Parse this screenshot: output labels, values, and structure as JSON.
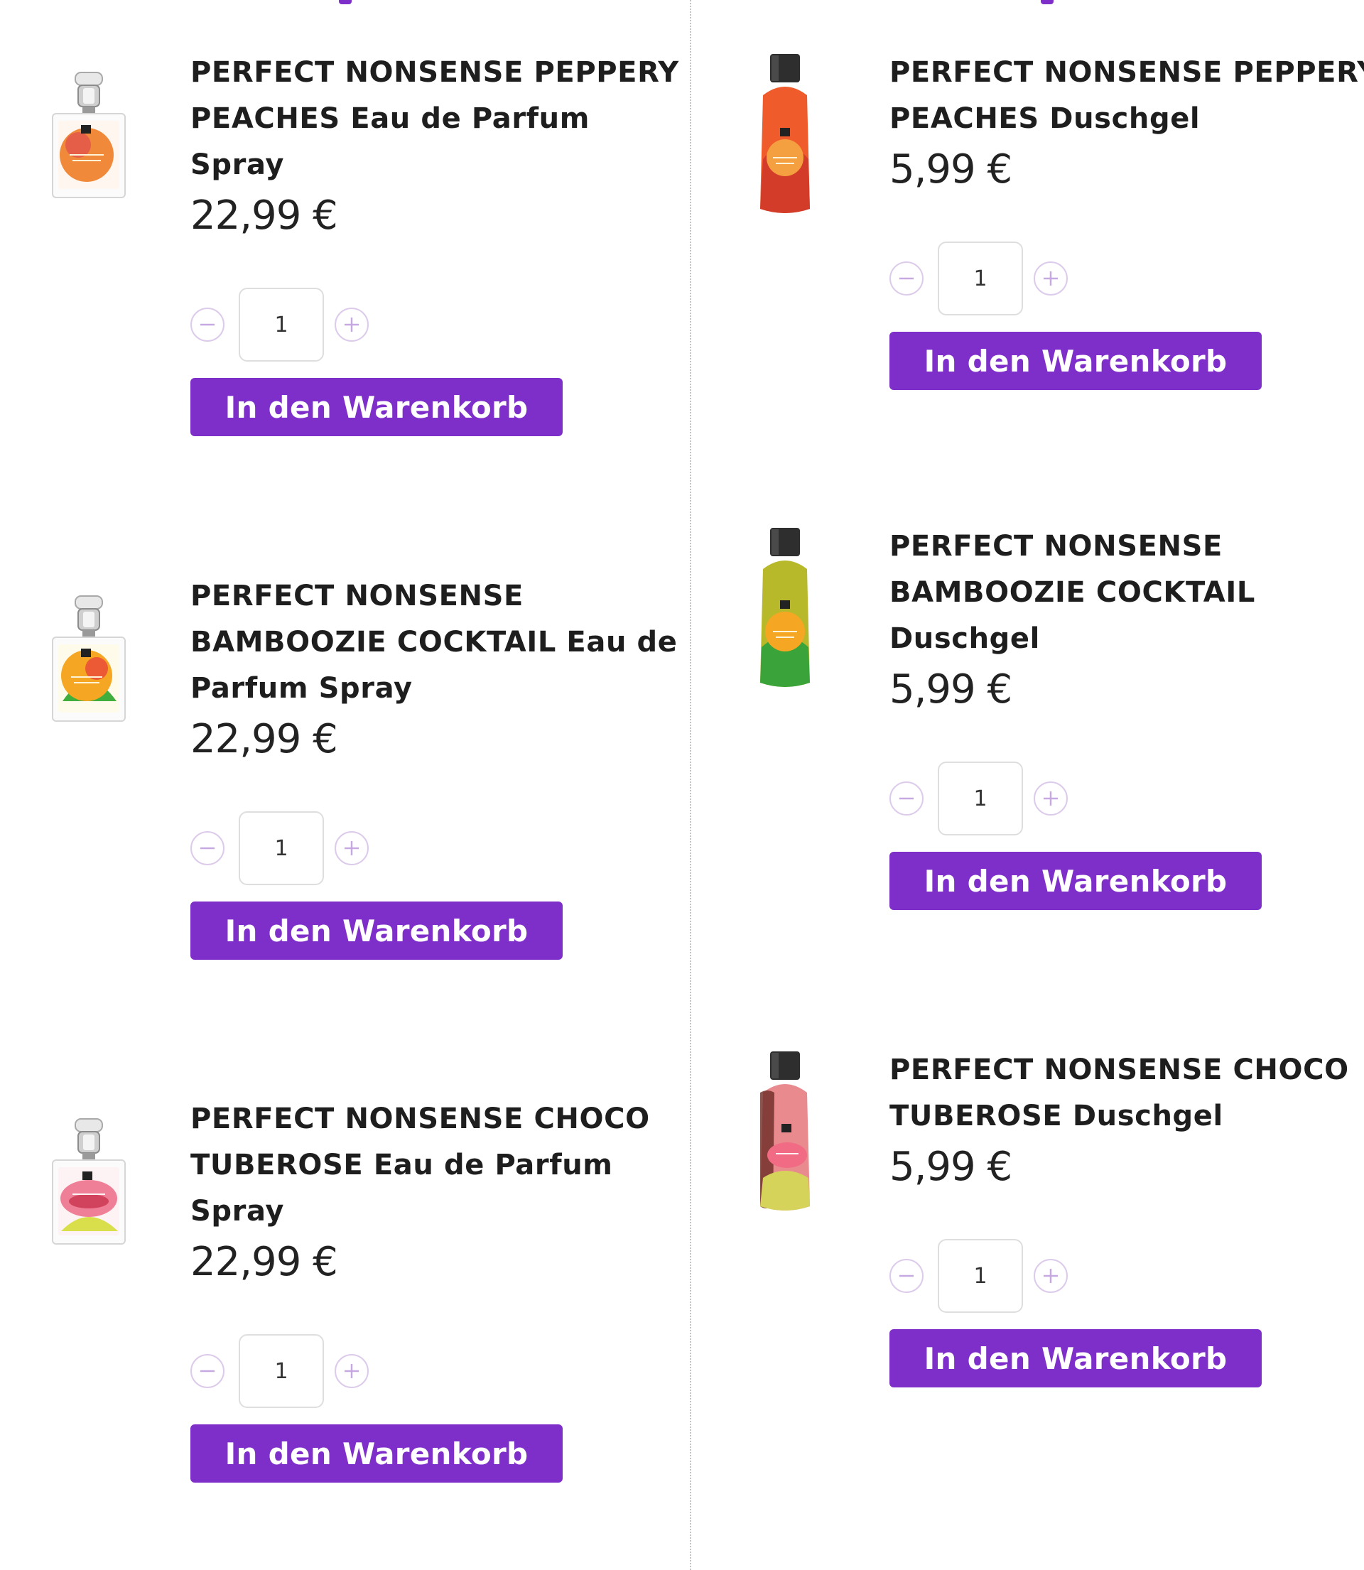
{
  "colors": {
    "accent": "#7f2fc9",
    "text": "#1e1e1e",
    "divider": "#c4c4c4",
    "qty_icon": "#c7a9e2"
  },
  "left_products": [
    {
      "title": "PERFECT NONSENSE PEPPERY PEACHES Eau de Parfum Spray",
      "price": "22,99 €",
      "quantity": "1",
      "cart_label": "In den Warenkorb",
      "image_icon": "perfume-bottle-icon"
    },
    {
      "title": "PERFECT NONSENSE BAMBOOZIE COCKTAIL Eau de Parfum Spray",
      "price": "22,99 €",
      "quantity": "1",
      "cart_label": "In den Warenkorb",
      "image_icon": "perfume-bottle-icon"
    },
    {
      "title": "PERFECT NONSENSE CHOCO TUBEROSE Eau de Parfum Spray",
      "price": "22,99 €",
      "quantity": "1",
      "cart_label": "In den Warenkorb",
      "image_icon": "perfume-bottle-icon"
    }
  ],
  "right_products": [
    {
      "title": "PERFECT NONSENSE PEPPERY PEACHES Duschgel",
      "price": "5,99 €",
      "quantity": "1",
      "cart_label": "In den Warenkorb",
      "image_icon": "shower-gel-bottle-icon"
    },
    {
      "title": "PERFECT NONSENSE BAMBOOZIE COCKTAIL Duschgel",
      "price": "5,99 €",
      "quantity": "1",
      "cart_label": "In den Warenkorb",
      "image_icon": "shower-gel-bottle-icon"
    },
    {
      "title": "PERFECT NONSENSE CHOCO TUBEROSE Duschgel",
      "price": "5,99 €",
      "quantity": "1",
      "cart_label": "In den Warenkorb",
      "image_icon": "shower-gel-bottle-icon"
    }
  ]
}
